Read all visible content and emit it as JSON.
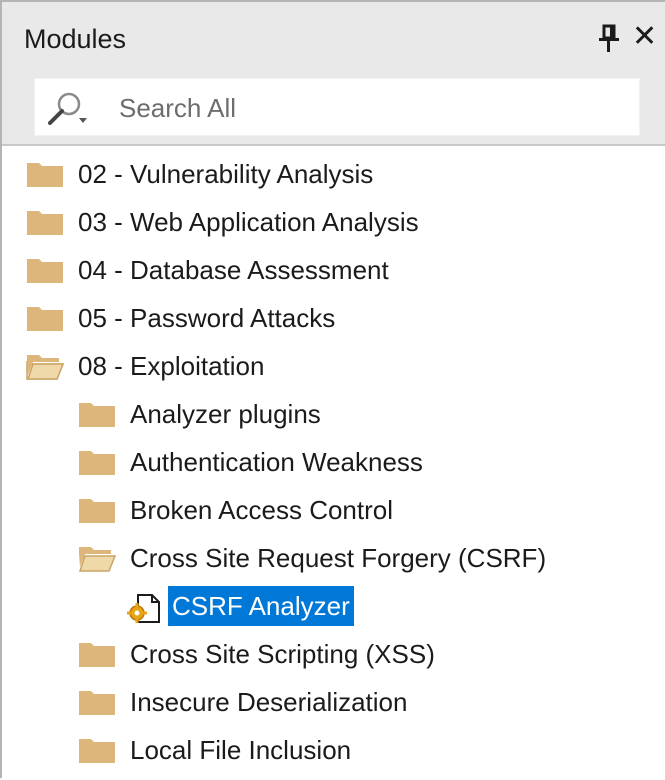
{
  "panel": {
    "title": "Modules",
    "pin_icon": "pin-icon",
    "close_icon": "close-icon",
    "close_glyph": "✕"
  },
  "search": {
    "placeholder": "Search All",
    "value": "",
    "icon": "search-icon"
  },
  "tree": {
    "items": [
      {
        "label": "02 - Vulnerability Analysis",
        "icon": "folder-closed-icon",
        "level": 0
      },
      {
        "label": "03 - Web Application Analysis",
        "icon": "folder-closed-icon",
        "level": 0
      },
      {
        "label": "04 - Database Assessment",
        "icon": "folder-closed-icon",
        "level": 0
      },
      {
        "label": "05 - Password Attacks",
        "icon": "folder-closed-icon",
        "level": 0
      },
      {
        "label": "08 - Exploitation",
        "icon": "folder-open-icon",
        "level": 0,
        "expanded": true
      },
      {
        "label": "Analyzer plugins",
        "icon": "folder-closed-icon",
        "level": 1
      },
      {
        "label": "Authentication Weakness",
        "icon": "folder-closed-icon",
        "level": 1
      },
      {
        "label": "Broken Access Control",
        "icon": "folder-closed-icon",
        "level": 1
      },
      {
        "label": "Cross Site Request Forgery (CSRF)",
        "icon": "folder-open-icon",
        "level": 1,
        "expanded": true
      },
      {
        "label": "CSRF Analyzer",
        "icon": "module-file-icon",
        "level": 2,
        "selected": true
      },
      {
        "label": "Cross Site Scripting (XSS)",
        "icon": "folder-closed-icon",
        "level": 1
      },
      {
        "label": "Insecure Deserialization",
        "icon": "folder-closed-icon",
        "level": 1
      },
      {
        "label": "Local File Inclusion",
        "icon": "folder-closed-icon",
        "level": 1
      }
    ]
  },
  "colors": {
    "header_bg": "#e9e9e9",
    "folder": "#dcb67a",
    "selection": "#0078d7",
    "text": "#1b1b1b"
  }
}
